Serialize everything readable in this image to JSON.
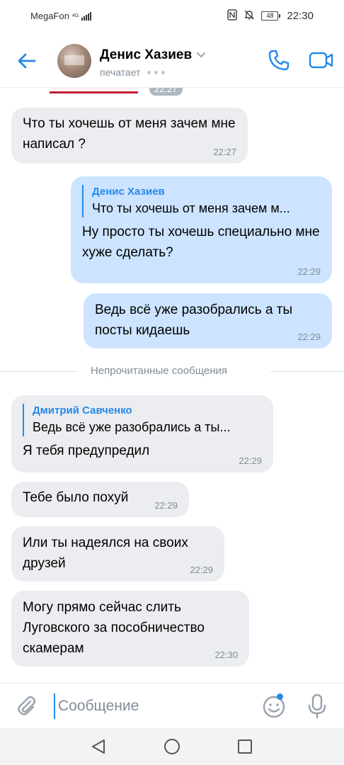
{
  "status_bar": {
    "carrier": "MegaFon",
    "network": "4G",
    "battery": "48",
    "time": "22:30"
  },
  "header": {
    "contact_name": "Денис Хазиев",
    "status": "печатает"
  },
  "peek_time": "22:27",
  "messages": [
    {
      "direction": "in",
      "text": "Что ты хочешь от меня зачем мне написал ?",
      "time": "22:27"
    },
    {
      "direction": "out",
      "reply_name": "Денис Хазиев",
      "reply_text": "Что ты хочешь от меня зачем м...",
      "text": "Ну просто ты хочешь специально мне хуже сделать?",
      "time": "22:29"
    },
    {
      "direction": "out",
      "text": "Ведь всё уже разобрались а ты посты кидаешь",
      "time": "22:29"
    },
    {
      "direction": "in",
      "reply_name": "Дмитрий Савченко",
      "reply_text": "Ведь всё уже разобрались а ты...",
      "text": "Я тебя предупредил",
      "time": "22:29"
    },
    {
      "direction": "in",
      "text": "Тебе было похуй",
      "time": "22:29"
    },
    {
      "direction": "in",
      "text": "Или ты надеялся на своих друзей",
      "time": "22:29"
    },
    {
      "direction": "in",
      "text": "Могу прямо сейчас слить Луговского за пособничество скамерам",
      "time": "22:30"
    }
  ],
  "unread_divider": "Непрочитанные сообщения",
  "composer": {
    "placeholder": "Сообщение"
  },
  "colors": {
    "accent": "#2688eb",
    "incoming_bubble": "#ebedf0",
    "outgoing_bubble": "#cce4ff",
    "secondary_text": "#818c99"
  },
  "icons": [
    "back-arrow-icon",
    "phone-icon",
    "video-camera-icon",
    "paperclip-icon",
    "emoji-icon",
    "microphone-icon",
    "nav-back-icon",
    "nav-home-icon",
    "nav-recent-icon"
  ]
}
